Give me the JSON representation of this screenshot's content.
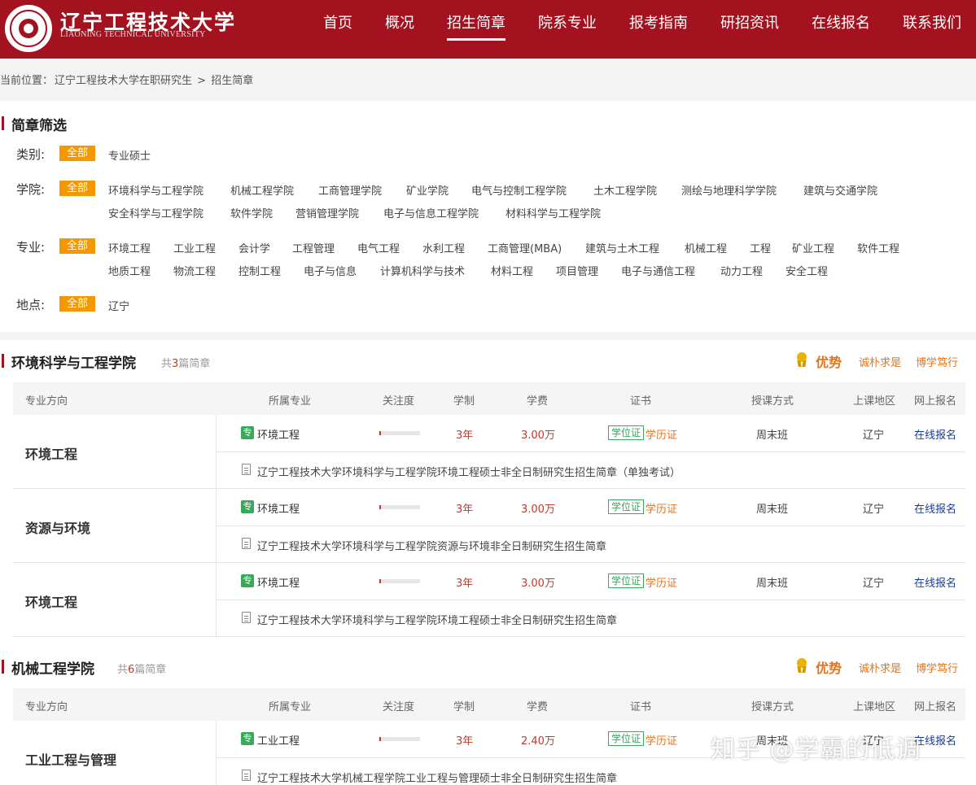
{
  "header": {
    "brand_cn": "辽宁工程技术大学",
    "brand_en": "LIAONING TECHNICAL UNIVERSITY",
    "nav": [
      "首页",
      "概况",
      "招生简章",
      "院系专业",
      "报考指南",
      "研招资讯",
      "在线报名",
      "联系我们"
    ],
    "active_nav": "招生简章",
    "accent": "#a4111f"
  },
  "breadcrumb": {
    "prefix": "当前位置：",
    "items": [
      "辽宁工程技术大学在职研究生",
      ">",
      "招生简章"
    ]
  },
  "filter": {
    "title": "简章筛选",
    "all_label": "全部",
    "category": {
      "label": "类别:",
      "options": [
        "专业硕士"
      ]
    },
    "college": {
      "label": "学院:",
      "options": [
        "环境科学与工程学院",
        "机械工程学院",
        "工商管理学院",
        "矿业学院",
        "电气与控制工程学院",
        "土木工程学院",
        "测绘与地理科学学院",
        "建筑与交通学院",
        "安全科学与工程学院",
        "软件学院",
        "营销管理学院",
        "电子与信息工程学院",
        "材料科学与工程学院"
      ]
    },
    "major": {
      "label": "专业:",
      "options": [
        "环境工程",
        "工业工程",
        "会计学",
        "工程管理",
        "电气工程",
        "水利工程",
        "工商管理(MBA)",
        "建筑与土木工程",
        "机械工程",
        "工程",
        "矿业工程",
        "软件工程",
        "地质工程",
        "物流工程",
        "控制工程",
        "电子与信息",
        "计算机科学与技术",
        "材料工程",
        "项目管理",
        "电子与通信工程",
        "动力工程",
        "安全工程"
      ]
    },
    "location": {
      "label": "地点:",
      "options": [
        "辽宁"
      ]
    }
  },
  "advantage": {
    "title": "优势",
    "tags": [
      "诚朴求是",
      "博学笃行"
    ]
  },
  "table_headers": [
    "专业方向",
    "所属专业",
    "关注度",
    "学制",
    "学费",
    "证书",
    "授课方式",
    "上课地区",
    "网上报名"
  ],
  "sections": [
    {
      "title": "环境科学与工程学院",
      "count_prefix": "共",
      "count": "3",
      "count_suffix": "篇简章",
      "groups": [
        {
          "direction": "环境工程",
          "zhuan": "专",
          "major": "环境工程",
          "popularity": 0.03,
          "duration": "3年",
          "fee": "3.00万",
          "cert_badge": "学位证",
          "cert_text": "学历证",
          "mode": "周末班",
          "region": "辽宁",
          "apply": "在线报名",
          "brochure": "辽宁工程技术大学环境科学与工程学院环境工程硕士非全日制研究生招生简章（单独考试）"
        },
        {
          "direction": "资源与环境",
          "zhuan": "专",
          "major": "环境工程",
          "popularity": 0.03,
          "duration": "3年",
          "fee": "3.00万",
          "cert_badge": "学位证",
          "cert_text": "学历证",
          "mode": "周末班",
          "region": "辽宁",
          "apply": "在线报名",
          "brochure": "辽宁工程技术大学环境科学与工程学院资源与环境非全日制研究生招生简章"
        },
        {
          "direction": "环境工程",
          "zhuan": "专",
          "major": "环境工程",
          "popularity": 0.03,
          "duration": "3年",
          "fee": "3.00万",
          "cert_badge": "学位证",
          "cert_text": "学历证",
          "mode": "周末班",
          "region": "辽宁",
          "apply": "在线报名",
          "brochure": "辽宁工程技术大学环境科学与工程学院环境工程硕士非全日制研究生招生简章"
        }
      ]
    },
    {
      "title": "机械工程学院",
      "count_prefix": "共",
      "count": "6",
      "count_suffix": "篇简章",
      "groups": [
        {
          "direction": "工业工程与管理",
          "zhuan": "专",
          "major": "工业工程",
          "popularity": 0.03,
          "duration": "3年",
          "fee": "2.40万",
          "cert_badge": "学位证",
          "cert_text": "学历证",
          "mode": "周末班",
          "region": "辽宁",
          "apply": "在线报名",
          "brochure": "辽宁工程技术大学机械工程学院工业工程与管理硕士非全日制研究生招生简章"
        }
      ]
    }
  ],
  "watermark": "知乎 @学霸的低调"
}
